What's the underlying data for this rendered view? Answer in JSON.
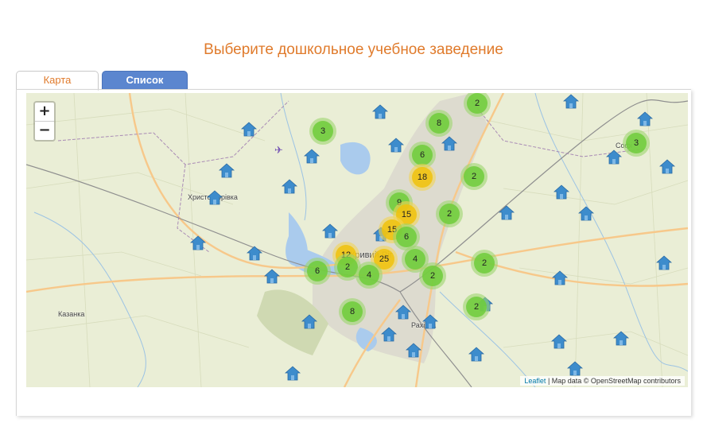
{
  "header": {
    "title": "Выберите дошкольное учебное заведение"
  },
  "tabs": [
    {
      "label": "Карта",
      "active": true
    },
    {
      "label": "Список",
      "active": false
    }
  ],
  "map": {
    "zoom_in_label": "+",
    "zoom_out_label": "−",
    "attribution": {
      "leaflet": "Leaflet",
      "rest": " | Map data © OpenStreetMap contributors"
    },
    "places": [
      {
        "label": "Христофорівка"
      },
      {
        "label": "Казанка"
      },
      {
        "label": "Кривий Ріг"
      },
      {
        "label": "Рахівка"
      },
      {
        "label": "Софі"
      }
    ],
    "clusters": [
      {
        "count": "2",
        "level": "small"
      },
      {
        "count": "8",
        "level": "small"
      },
      {
        "count": "3",
        "level": "small"
      },
      {
        "count": "6",
        "level": "small"
      },
      {
        "count": "18",
        "level": "medium"
      },
      {
        "count": "2",
        "level": "small"
      },
      {
        "count": "3",
        "level": "small"
      },
      {
        "count": "9",
        "level": "small"
      },
      {
        "count": "15",
        "level": "medium"
      },
      {
        "count": "2",
        "level": "small"
      },
      {
        "count": "15",
        "level": "medium"
      },
      {
        "count": "6",
        "level": "small"
      },
      {
        "count": "12",
        "level": "medium"
      },
      {
        "count": "25",
        "level": "medium"
      },
      {
        "count": "4",
        "level": "small"
      },
      {
        "count": "6",
        "level": "small"
      },
      {
        "count": "2",
        "level": "small"
      },
      {
        "count": "4",
        "level": "small"
      },
      {
        "count": "2",
        "level": "small"
      },
      {
        "count": "2",
        "level": "small"
      },
      {
        "count": "2",
        "level": "small"
      },
      {
        "count": "8",
        "level": "small"
      }
    ],
    "colors": {
      "marker": "#3d8ccc",
      "road": "#f7c88a",
      "water": "#aacbed",
      "urban": "#d9d6cd"
    }
  }
}
